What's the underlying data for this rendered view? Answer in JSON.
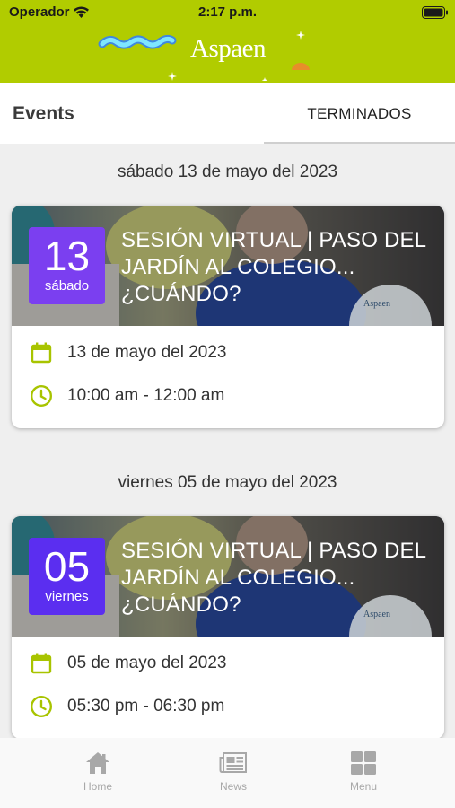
{
  "status_bar": {
    "carrier": "Operador",
    "time": "2:17 p.m."
  },
  "header": {
    "logo_text": "Aspaen",
    "brand_color": "#b1cc00"
  },
  "tabs": {
    "events_label": "Events",
    "ended_label": "TERMINADOS"
  },
  "events": [
    {
      "group_date": "sábado 13 de mayo del 2023",
      "badge_day": "13",
      "badge_weekday": "sábado",
      "title": "SESIÓN VIRTUAL | PASO DEL JARDÍN AL COLEGIO... ¿CUÁNDO?",
      "date": "13 de mayo del 2023",
      "time": "10:00 am - 12:00 am",
      "watermark": "Aspaen"
    },
    {
      "group_date": "viernes 05 de mayo del 2023",
      "badge_day": "05",
      "badge_weekday": "viernes",
      "title": "SESIÓN VIRTUAL | PASO DEL JARDÍN AL COLEGIO... ¿CUÁNDO?",
      "date": "05 de mayo del 2023",
      "time": "05:30 pm - 06:30 pm",
      "watermark": "Aspaen"
    }
  ],
  "bottom_nav": [
    {
      "label": "Home",
      "icon": "home-icon"
    },
    {
      "label": "News",
      "icon": "news-icon"
    },
    {
      "label": "Menu",
      "icon": "grid-icon"
    }
  ],
  "colors": {
    "badge": "#7b3ff0",
    "icon_accent": "#a8c400",
    "nav_inactive": "#a8a8a8"
  }
}
